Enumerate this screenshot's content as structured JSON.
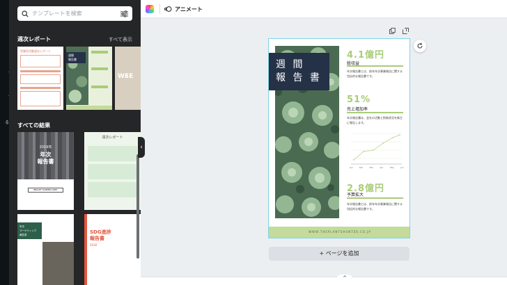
{
  "rail": {
    "items": [
      ".",
      ".",
      "る"
    ]
  },
  "search": {
    "placeholder": "テンプレートを検索"
  },
  "sections": {
    "weekly": {
      "title": "週次レポート",
      "see_all": "すべて表示"
    },
    "all": {
      "title": "すべての結果"
    }
  },
  "thumbs": {
    "t1": {
      "title": "営業所活動週次レポート"
    },
    "t2": {
      "title_lines": [
        "週間",
        "報告書"
      ]
    },
    "t3": {
      "title": "WEE"
    },
    "t4": {
      "year": "2019年",
      "lines": [
        "年次",
        "報告書"
      ],
      "company": "BRIGHT SCREEN CORP."
    },
    "t5": {
      "title": "週次レポート"
    },
    "t6": {
      "lines": [
        "年次",
        "マーケティング",
        "報告書"
      ]
    },
    "t7": {
      "lines": [
        "SDG進捗",
        "報告書"
      ],
      "sub": "2030"
    }
  },
  "toolbar": {
    "animate_label": "アニメート"
  },
  "doc": {
    "title_line1": "週 間",
    "title_line2": "報 告 書",
    "stats": [
      {
        "value": "4.1億円",
        "label": "総収益",
        "body": "年次報告書とは、前年年次事業報告に関する包括的な報告書です。"
      },
      {
        "value": "51%",
        "label": "売上増加率",
        "body": "年次報告書は、会社の活動と財務状況を株主に報告します。"
      },
      {
        "value": "2.8億円",
        "label": "予算拡大",
        "body": "年次報告書とは、前年年次事業報告に関する包括的な報告書です。"
      }
    ],
    "chart_ticks": [
      "Jan",
      "Feb",
      "Mar",
      "Apr",
      "May",
      "Jun"
    ],
    "footer": "WWW.THEPLANTSHUNTER.CO.JP"
  },
  "canvas": {
    "add_page_label": "+ ページを追加"
  },
  "colors": {
    "accent_green": "#a9cc78",
    "navy": "#253147",
    "selection": "#7ed4e6"
  }
}
